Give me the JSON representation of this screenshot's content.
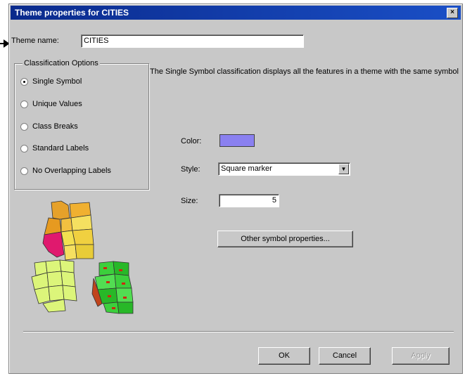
{
  "dialog": {
    "title": "Theme properties for CITIES",
    "close_symbol": "×"
  },
  "theme_name": {
    "label": "Theme name:",
    "value": "CITIES"
  },
  "classification": {
    "group_title": "Classification Options",
    "options": [
      {
        "label": "Single Symbol",
        "selected": true
      },
      {
        "label": "Unique Values",
        "selected": false
      },
      {
        "label": "Class Breaks",
        "selected": false
      },
      {
        "label": "Standard Labels",
        "selected": false
      },
      {
        "label": "No Overlapping Labels",
        "selected": false
      }
    ]
  },
  "description": "The Single Symbol classification displays all the features in a theme with the same symbol",
  "symbol": {
    "color_label": "Color:",
    "color_value": "#8a80f0",
    "style_label": "Style:",
    "style_value": "Square marker",
    "size_label": "Size:",
    "size_value": "5",
    "other_button": "Other symbol properties..."
  },
  "footer": {
    "ok": "OK",
    "cancel": "Cancel",
    "apply": "Apply"
  },
  "colors": {
    "title_bar": "#0a2a8c",
    "dialog_bg": "#c8c8c8"
  }
}
